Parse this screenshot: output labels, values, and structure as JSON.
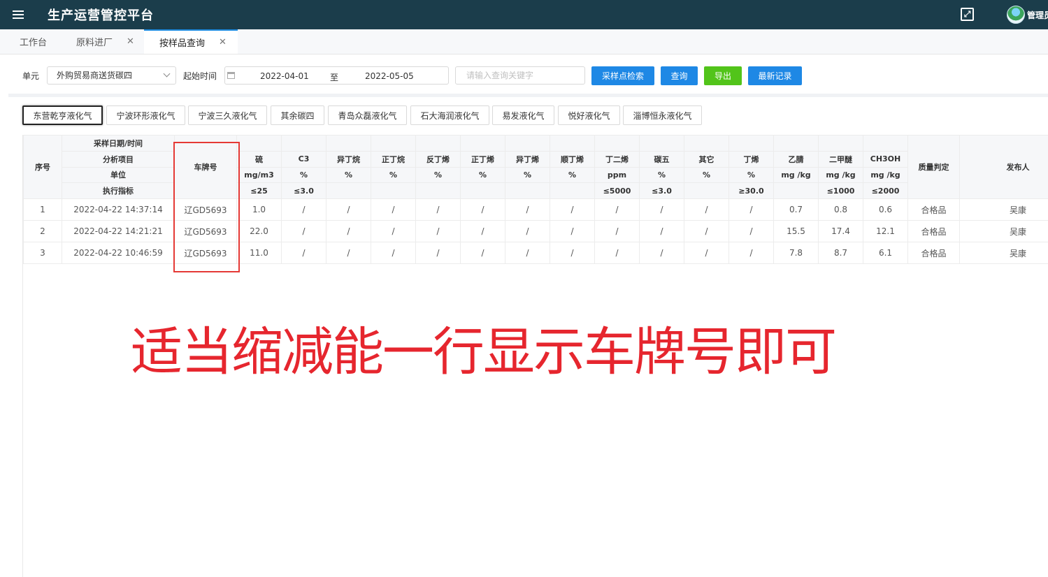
{
  "app": {
    "title": "生产运营管控平台",
    "user": "管理员"
  },
  "tabs": [
    {
      "label": "工作台",
      "closable": false,
      "active": false
    },
    {
      "label": "原料进厂",
      "closable": true,
      "active": false
    },
    {
      "label": "按样品查询",
      "closable": true,
      "active": true
    }
  ],
  "filter": {
    "unit_label": "单元",
    "unit_value": "外购贸易商送货碳四",
    "start_label": "起始时间",
    "date_from": "2022-04-01",
    "date_sep": "至",
    "date_to": "2022-05-05",
    "keyword_placeholder": "请输入查询关键字",
    "buttons": [
      {
        "label": "采样点检索",
        "color": "#1e88e5"
      },
      {
        "label": "查询",
        "color": "#1e88e5"
      },
      {
        "label": "导出",
        "color": "#52c41a"
      },
      {
        "label": "最新记录",
        "color": "#1e88e5"
      }
    ]
  },
  "sources": [
    "东营乾亨液化气",
    "宁波环形液化气",
    "宁波三久液化气",
    "其余碳四",
    "青岛众磊液化气",
    "石大海润液化气",
    "易发液化气",
    "悦好液化气",
    "淄博恒永液化气"
  ],
  "table": {
    "header": {
      "index": "序号",
      "meta": [
        "采样日期/时间",
        "分析项目",
        "单位",
        "执行指标"
      ],
      "plate": "车牌号",
      "quality": "质量判定",
      "publisher": "发布人"
    },
    "columns": [
      {
        "name": "硫",
        "unit": "mg/m3",
        "spec": "≤25"
      },
      {
        "name": "C3",
        "unit": "%",
        "spec": "≤3.0"
      },
      {
        "name": "异丁烷",
        "unit": "%",
        "spec": ""
      },
      {
        "name": "正丁烷",
        "unit": "%",
        "spec": ""
      },
      {
        "name": "反丁烯",
        "unit": "%",
        "spec": ""
      },
      {
        "name": "正丁烯",
        "unit": "%",
        "spec": ""
      },
      {
        "name": "异丁烯",
        "unit": "%",
        "spec": ""
      },
      {
        "name": "顺丁烯",
        "unit": "%",
        "spec": ""
      },
      {
        "name": "丁二烯",
        "unit": "ppm",
        "spec": "≤5000"
      },
      {
        "name": "碳五",
        "unit": "%",
        "spec": "≤3.0"
      },
      {
        "name": "其它",
        "unit": "%",
        "spec": ""
      },
      {
        "name": "丁烯",
        "unit": "%",
        "spec": "≥30.0"
      },
      {
        "name": "乙腈",
        "unit": "mg /kg",
        "spec": ""
      },
      {
        "name": "二甲醚",
        "unit": "mg /kg",
        "spec": "≤1000"
      },
      {
        "name": "CH3OH",
        "unit": "mg /kg",
        "spec": "≤2000"
      }
    ],
    "rows": [
      {
        "index": "1",
        "time": "2022-04-22 14:37:14",
        "plate": "辽GD5693",
        "values": [
          "1.0",
          "/",
          "/",
          "/",
          "/",
          "/",
          "/",
          "/",
          "/",
          "/",
          "/",
          "/",
          "0.7",
          "0.8",
          "0.6"
        ],
        "quality": "合格品",
        "publisher": "吴康"
      },
      {
        "index": "2",
        "time": "2022-04-22 14:21:21",
        "plate": "辽GD5693",
        "values": [
          "22.0",
          "/",
          "/",
          "/",
          "/",
          "/",
          "/",
          "/",
          "/",
          "/",
          "/",
          "/",
          "15.5",
          "17.4",
          "12.1"
        ],
        "quality": "合格品",
        "publisher": "吴康"
      },
      {
        "index": "3",
        "time": "2022-04-22 10:46:59",
        "plate": "辽GD5693",
        "values": [
          "11.0",
          "/",
          "/",
          "/",
          "/",
          "/",
          "/",
          "/",
          "/",
          "/",
          "/",
          "/",
          "7.8",
          "8.7",
          "6.1"
        ],
        "quality": "合格品",
        "publisher": "吴康"
      }
    ]
  },
  "annotation": "适当缩减能一行显示车牌号即可",
  "colors": {
    "header_bg": "#1b3d4b",
    "primary": "#1e88e5",
    "success": "#52c41a",
    "annotation": "#e6262e"
  }
}
